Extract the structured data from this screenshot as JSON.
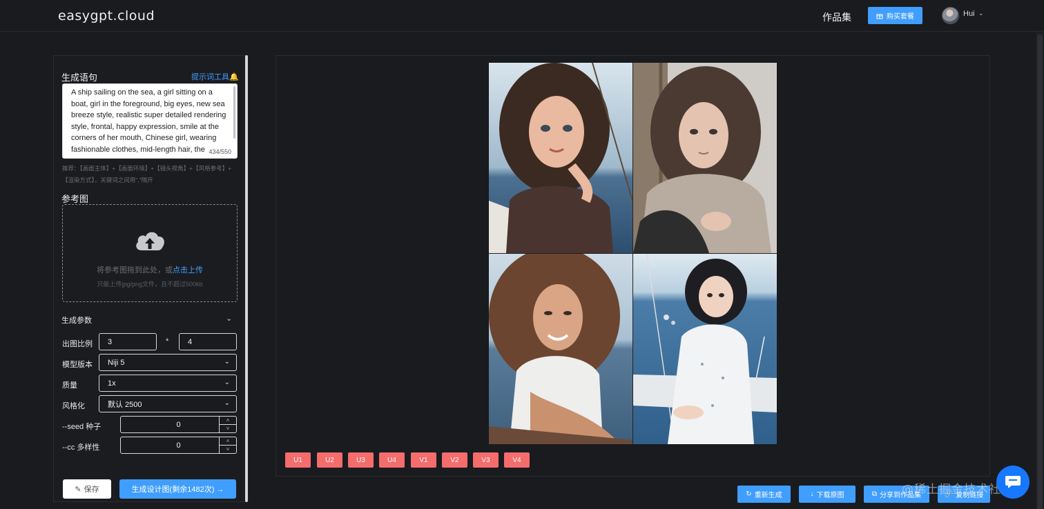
{
  "header": {
    "logo": "easygpt.cloud",
    "nav_works": "作品集",
    "buy_button": "购买套餐",
    "user_name": "Hui"
  },
  "prompt": {
    "title": "生成语句",
    "tool_link": "提示词工具",
    "text": "A ship sailing on the sea, a girl sitting on a boat, girl in the foreground, big eyes, new sea breeze style, realistic super detailed rendering style, frontal, happy expression, smile at the corners of her mouth, Chinese girl, wearing fashionable clothes, mid-length hair, the background is the sea and sky",
    "count": "434/550",
    "hint": "推荐：【画面主体】+【画面环境】+【镜头视角】+【风格参考】+【渲染方式】，关键词之间用\",\"隔开"
  },
  "reference": {
    "title": "参考图",
    "drop_text": "将参考图拖到此处，或",
    "upload_link": "点击上传",
    "tip": "只能上传jpg/png文件，且不超过500kb"
  },
  "params": {
    "title": "生成参数",
    "ratio_label": "出图比例",
    "ratio_w": "3",
    "ratio_sep": "*",
    "ratio_h": "4",
    "model_label": "模型版本",
    "model_value": "Niji 5",
    "quality_label": "质量",
    "quality_value": "1x",
    "stylize_label": "风格化",
    "stylize_value": "默认 2500",
    "seed_label": "--seed 种子",
    "seed_value": "0",
    "cc_label": "--cc 多样性",
    "cc_value": "0"
  },
  "buttons": {
    "save": "保存",
    "generate": "生成设计图(剩余1482次) →"
  },
  "variant_buttons": [
    "U1",
    "U2",
    "U3",
    "U4",
    "V1",
    "V2",
    "V3",
    "V4"
  ],
  "actions": {
    "regenerate": "重新生成",
    "download": "下载原图",
    "share": "分享到作品集",
    "copy_link": "复制链接"
  },
  "watermark": "@稀土掘金技术社区",
  "colors": {
    "accent": "#409eff",
    "variant": "#f56c6c",
    "background": "#1a1b1f"
  }
}
